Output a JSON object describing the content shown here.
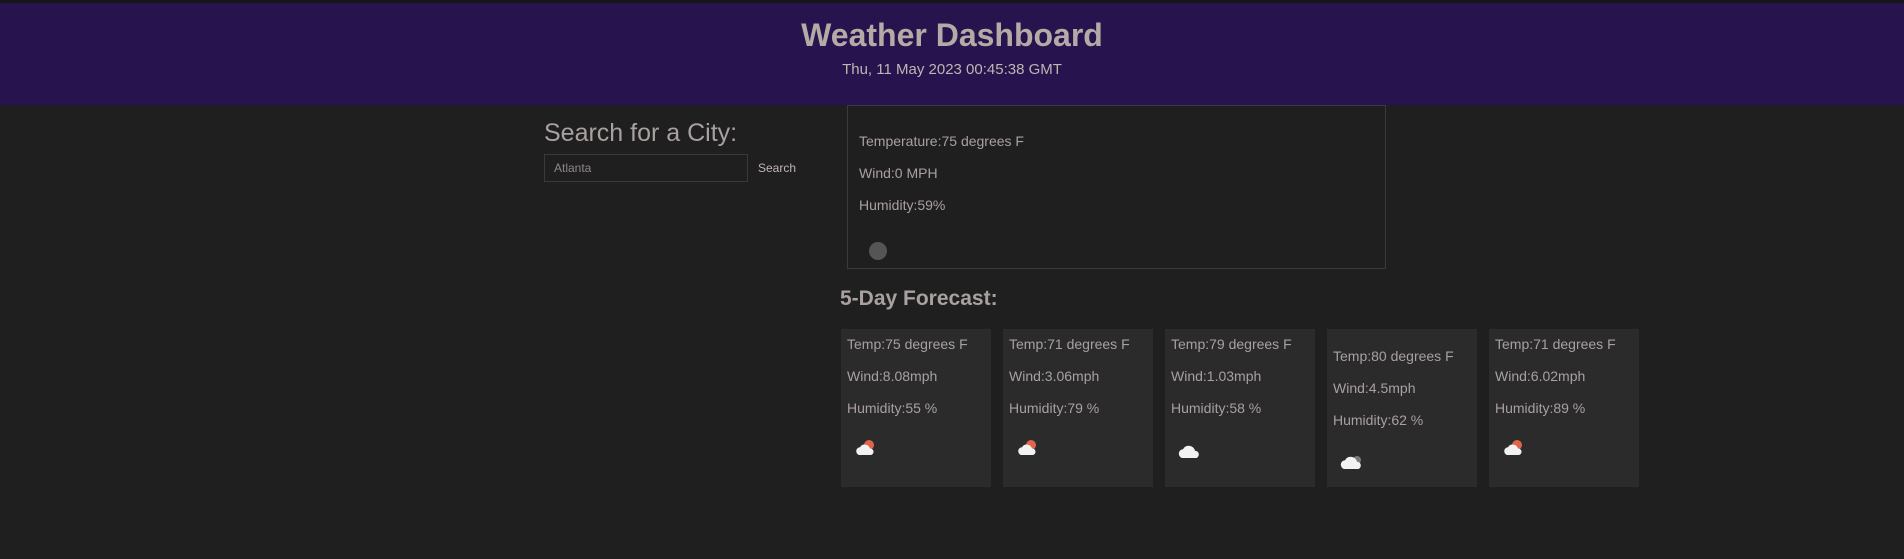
{
  "header": {
    "title": "Weather Dashboard",
    "datetime": "Thu, 11 May 2023 00:45:38 GMT"
  },
  "search": {
    "title": "Search for a City:",
    "input_value": "Atlanta",
    "button_label": "Search"
  },
  "current": {
    "temperature": "Temperature:75 degrees F",
    "wind": "Wind:0 MPH",
    "humidity": "Humidity:59%",
    "icon": "weather-icon-placeholder"
  },
  "forecast": {
    "title": "5-Day Forecast:",
    "days": [
      {
        "temp": "Temp:75 degrees F",
        "wind": "Wind:8.08mph",
        "humidity": "Humidity:55 %",
        "icon": "cloud-sun-icon"
      },
      {
        "temp": "Temp:71 degrees F",
        "wind": "Wind:3.06mph",
        "humidity": "Humidity:79 %",
        "icon": "cloud-sun-icon"
      },
      {
        "temp": "Temp:79 degrees F",
        "wind": "Wind:1.03mph",
        "humidity": "Humidity:58 %",
        "icon": "cloud-icon"
      },
      {
        "temp": "Temp:80 degrees F",
        "wind": "Wind:4.5mph",
        "humidity": "Humidity:62 %",
        "icon": "cloud-night-icon"
      },
      {
        "temp": "Temp:71 degrees F",
        "wind": "Wind:6.02mph",
        "humidity": "Humidity:89 %",
        "icon": "cloud-sun-icon"
      }
    ]
  }
}
